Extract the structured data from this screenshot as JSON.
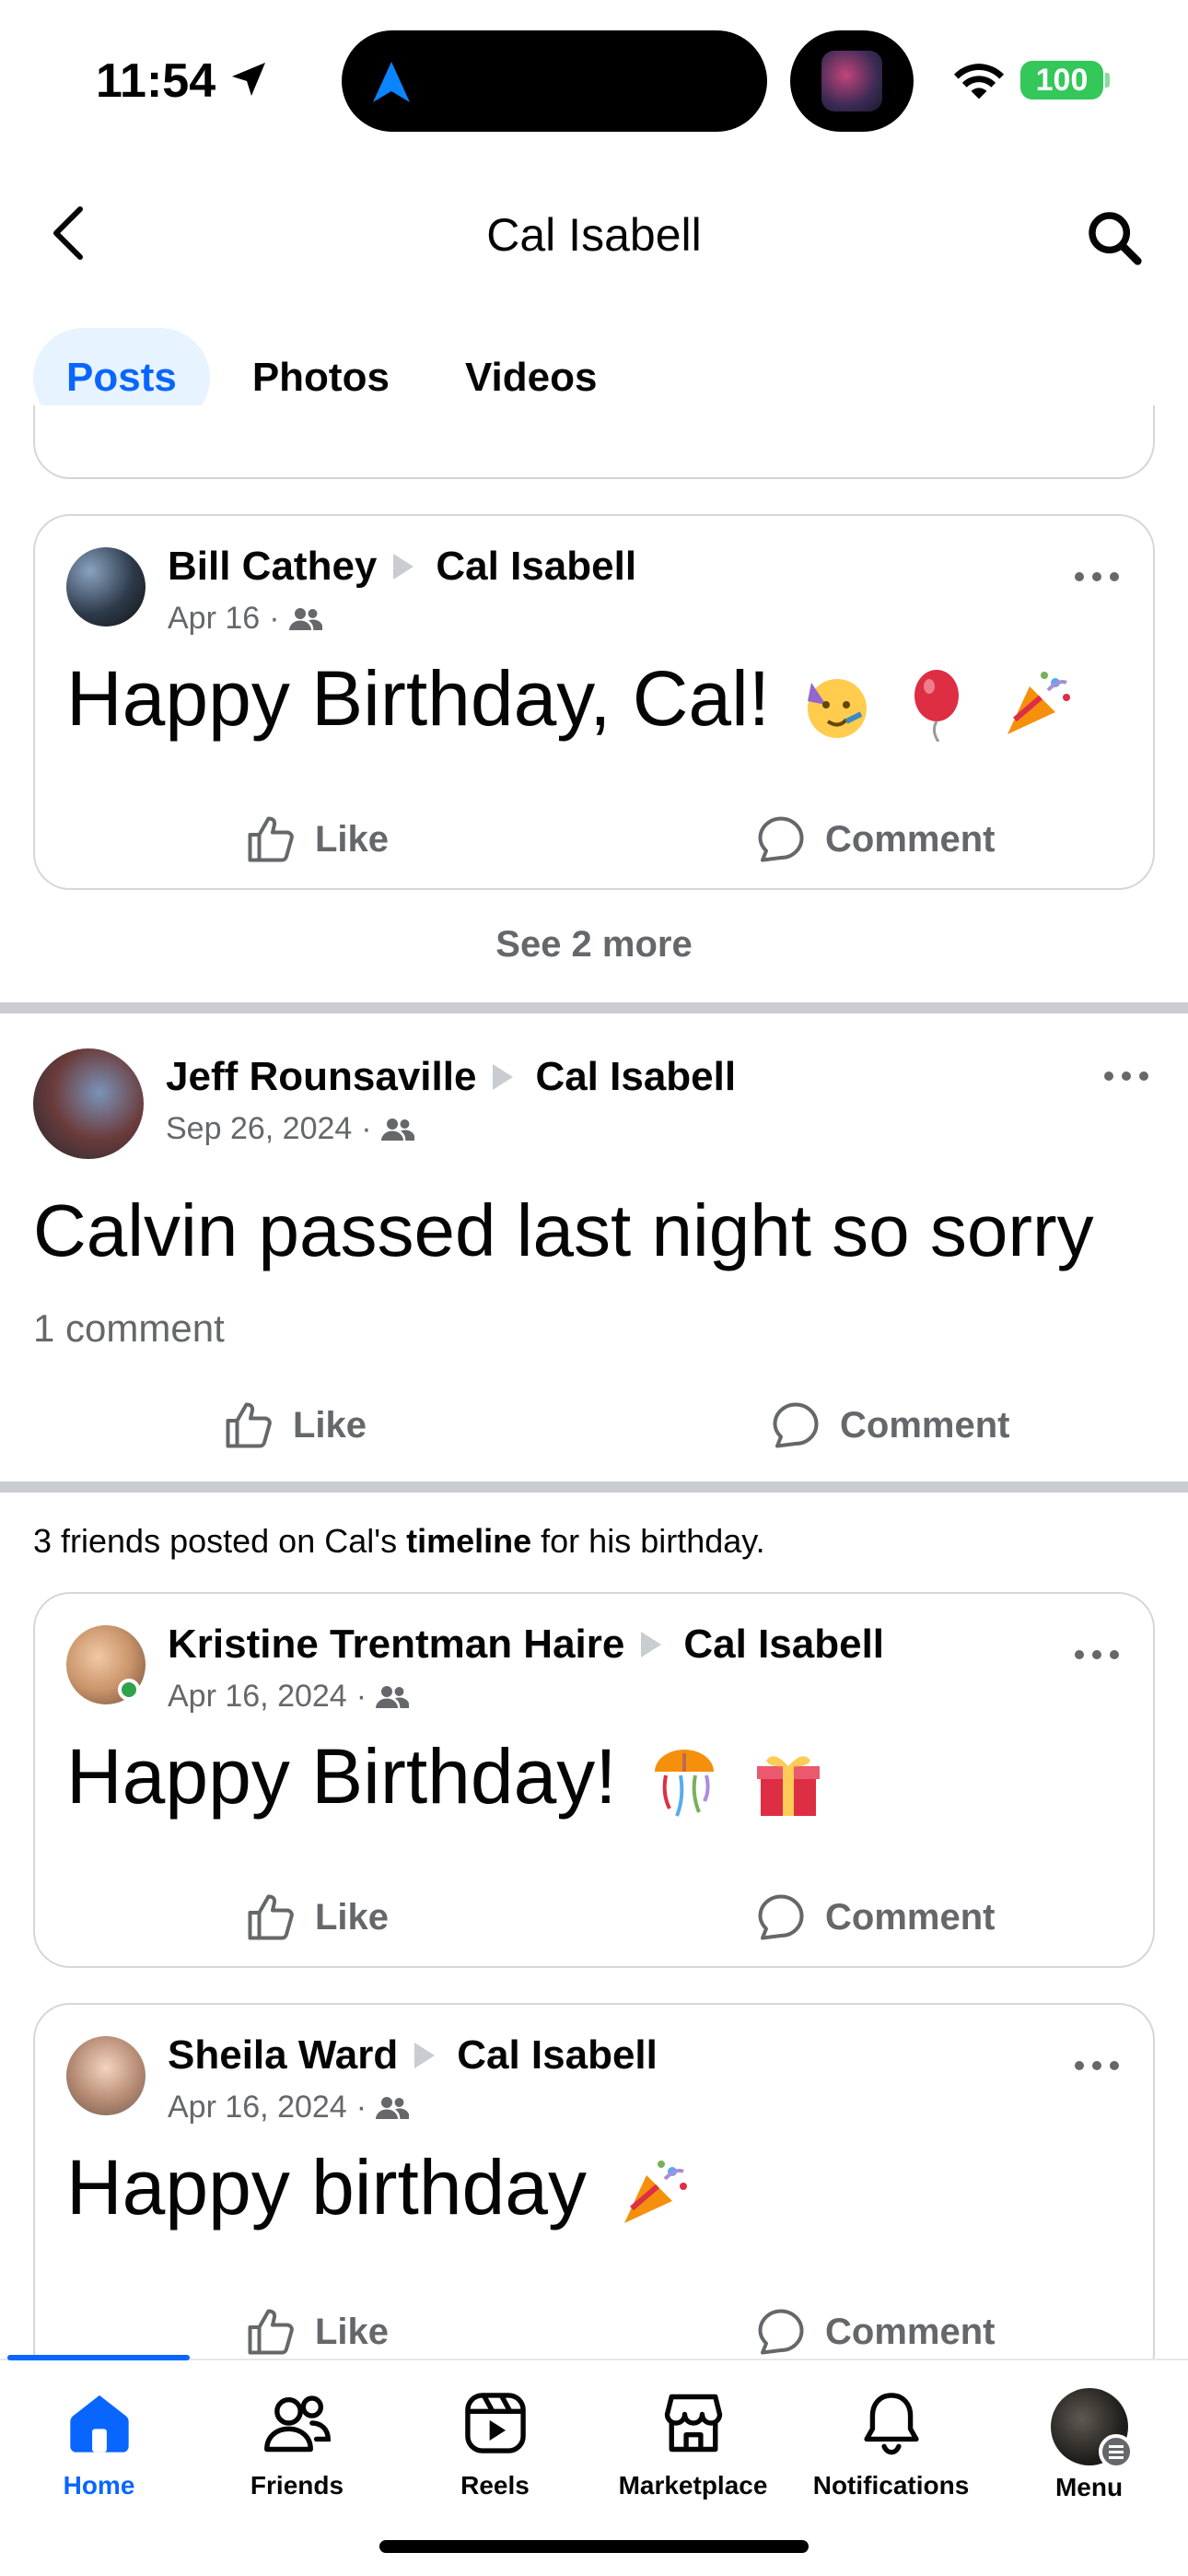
{
  "status_bar": {
    "time": "11:54",
    "battery": "100"
  },
  "header": {
    "title": "Cal Isabell"
  },
  "tabs": [
    {
      "label": "Posts",
      "active": true
    },
    {
      "label": "Photos",
      "active": false
    },
    {
      "label": "Videos",
      "active": false
    }
  ],
  "posts": [
    {
      "author": "Bill Cathey",
      "target": "Cal Isabell",
      "date": "Apr 16",
      "audience_icon": "friends-icon",
      "text": "Happy Birthday, Cal!",
      "emojis": [
        "partying-face-emoji",
        "balloon-emoji",
        "party-popper-emoji"
      ],
      "like_label": "Like",
      "comment_label": "Comment"
    },
    {
      "author": "Jeff Rounsaville",
      "target": "Cal Isabell",
      "date": "Sep 26, 2024",
      "audience_icon": "friends-icon",
      "text": "Calvin passed last night so sorry",
      "comment_count": "1 comment",
      "like_label": "Like",
      "comment_label": "Comment"
    },
    {
      "author": "Kristine Trentman Haire",
      "target": "Cal Isabell",
      "date": "Apr 16, 2024",
      "audience_icon": "friends-icon",
      "text": "Happy Birthday!",
      "emojis": [
        "confetti-ball-emoji",
        "wrapped-gift-emoji"
      ],
      "online": true,
      "like_label": "Like",
      "comment_label": "Comment"
    },
    {
      "author": "Sheila Ward",
      "target": "Cal Isabell",
      "date": "Apr 16, 2024",
      "audience_icon": "friends-icon",
      "text": "Happy birthday",
      "emojis": [
        "party-popper-emoji"
      ],
      "like_label": "Like",
      "comment_label": "Comment"
    }
  ],
  "see_more": "See 2 more",
  "birthday_summary": {
    "prefix": "3 friends posted on Cal's ",
    "bold": "timeline",
    "suffix": " for his birthday."
  },
  "bottom_nav": [
    {
      "label": "Home",
      "icon": "home-icon",
      "active": true
    },
    {
      "label": "Friends",
      "icon": "friends-icon",
      "active": false
    },
    {
      "label": "Reels",
      "icon": "reels-icon",
      "active": false
    },
    {
      "label": "Marketplace",
      "icon": "marketplace-icon",
      "active": false
    },
    {
      "label": "Notifications",
      "icon": "bell-icon",
      "active": false
    },
    {
      "label": "Menu",
      "icon": "profile-avatar",
      "active": false
    }
  ],
  "colors": {
    "accent": "#0866ff",
    "muted": "#65676b",
    "tab_active_bg": "#e7f3ff",
    "online": "#31a24c"
  }
}
